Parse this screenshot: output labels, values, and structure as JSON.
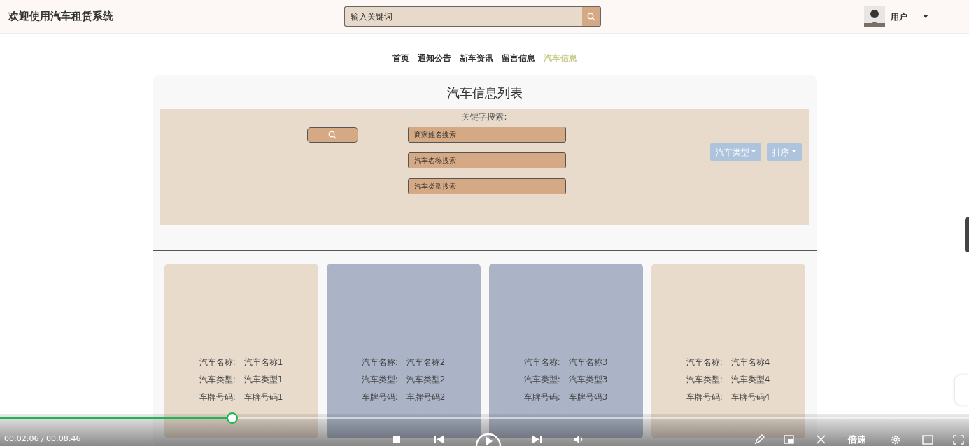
{
  "header": {
    "title": "欢迎使用汽车租赁系统",
    "search": {
      "placeholder": "输入关键词"
    },
    "user": {
      "name": "用户"
    }
  },
  "nav": [
    {
      "label": "首页",
      "selected": false
    },
    {
      "label": "通知公告",
      "selected": false
    },
    {
      "label": "新车资讯",
      "selected": false
    },
    {
      "label": "留言信息",
      "selected": false
    },
    {
      "label": "汽车信息",
      "selected": true
    }
  ],
  "list": {
    "title": "汽车信息列表",
    "search_label": "关键字搜索:",
    "fields": [
      {
        "placeholder": "商家姓名搜索"
      },
      {
        "placeholder": "汽车名称搜索"
      },
      {
        "placeholder": "汽车类型搜索"
      }
    ],
    "dropdowns": [
      "汽车类型",
      "排序"
    ]
  },
  "cards": [
    {
      "color": "#e8dbcc",
      "fields": [
        {
          "label": "汽车名称:",
          "value": "汽车名称1"
        },
        {
          "label": "汽车类型:",
          "value": "汽车类型1"
        },
        {
          "label": "车牌号码:",
          "value": "车牌号码1"
        }
      ]
    },
    {
      "color": "#aab4c6",
      "fields": [
        {
          "label": "汽车名称:",
          "value": "汽车名称2"
        },
        {
          "label": "汽车类型:",
          "value": "汽车类型2"
        },
        {
          "label": "车牌号码:",
          "value": "车牌号码2"
        }
      ]
    },
    {
      "color": "#aab4c6",
      "fields": [
        {
          "label": "汽车名称:",
          "value": "汽车名称3"
        },
        {
          "label": "汽车类型:",
          "value": "汽车类型3"
        },
        {
          "label": "车牌号码:",
          "value": "车牌号码3"
        }
      ]
    },
    {
      "color": "#e8dbcc",
      "fields": [
        {
          "label": "汽车名称:",
          "value": "汽车名称4"
        },
        {
          "label": "汽车类型:",
          "value": "汽车类型4"
        },
        {
          "label": "车牌号码:",
          "value": "车牌号码4"
        }
      ]
    }
  ],
  "player": {
    "level": 0.24,
    "time": "00:02:06 / 00:08:46",
    "speed": "倍速"
  }
}
